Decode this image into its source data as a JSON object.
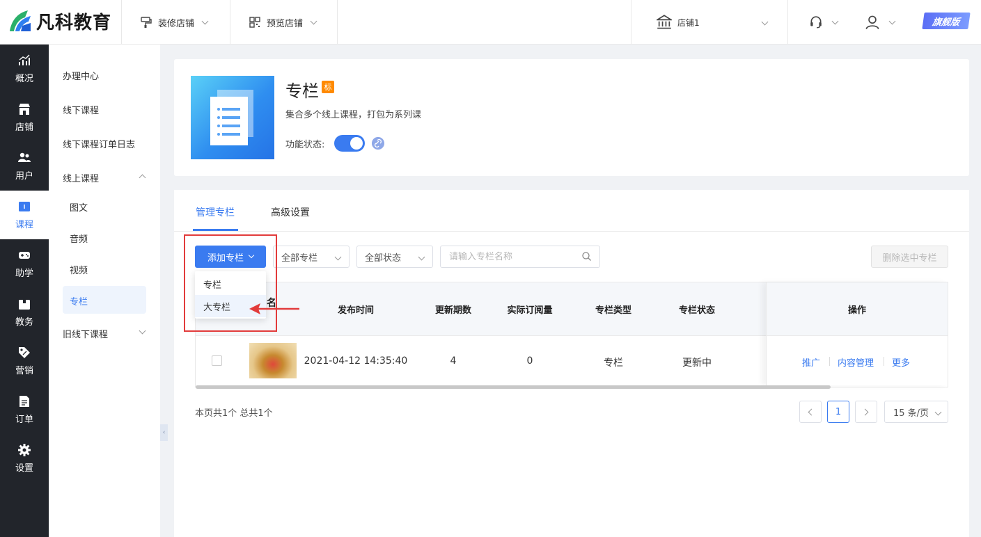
{
  "brand": {
    "name": "凡科教育",
    "edition_badge": "旗舰版"
  },
  "topnav": {
    "decorate": "装修店铺",
    "preview": "预览店铺",
    "store": "店铺1"
  },
  "dark_sidebar": [
    {
      "label": "概况",
      "icon": "chart-icon"
    },
    {
      "label": "店铺",
      "icon": "store-icon"
    },
    {
      "label": "用户",
      "icon": "users-icon"
    },
    {
      "label": "课程",
      "icon": "book-icon",
      "active": true
    },
    {
      "label": "助学",
      "icon": "gamepad-icon"
    },
    {
      "label": "教务",
      "icon": "briefcase-icon"
    },
    {
      "label": "营销",
      "icon": "tag-icon"
    },
    {
      "label": "订单",
      "icon": "document-icon"
    },
    {
      "label": "设置",
      "icon": "gear-icon"
    }
  ],
  "sub_sidebar": {
    "items": [
      "办理中心",
      "线下课程",
      "线下课程订单日志",
      "线上课程"
    ],
    "online_children": [
      "图文",
      "音频",
      "视频",
      "专栏"
    ],
    "legacy": "旧线下课程",
    "active": "专栏"
  },
  "product": {
    "title": "专栏",
    "badge": "标",
    "description": "集合多个线上课程，打包为系列课",
    "status_label": "功能状态:",
    "enabled": true
  },
  "tabs": [
    "管理专栏",
    "高级设置"
  ],
  "toolbar": {
    "add_label": "添加专栏",
    "filter_type": "全部专栏",
    "filter_status": "全部状态",
    "search_placeholder": "请输入专栏名称",
    "delete_label": "删除选中专栏"
  },
  "dropdown": [
    "专栏",
    "大专栏"
  ],
  "table": {
    "name_header_fragment": "名",
    "headers": [
      "发布时间",
      "更新期数",
      "实际订阅量",
      "专栏类型",
      "专栏状态",
      "操作"
    ],
    "rows": [
      {
        "time": "2021-04-12 14:35:40",
        "issues": "4",
        "subs": "0",
        "type": "专栏",
        "status": "更新中"
      }
    ],
    "actions": [
      "推广",
      "内容管理",
      "更多"
    ]
  },
  "pagination": {
    "summary": "本页共1个 总共1个",
    "current": "1",
    "page_size": "15 条/页"
  },
  "colors": {
    "accent": "#3a7bf0",
    "annotation": "#e23b3b",
    "badge": "#ff8a00",
    "sidebar": "#22252b"
  }
}
